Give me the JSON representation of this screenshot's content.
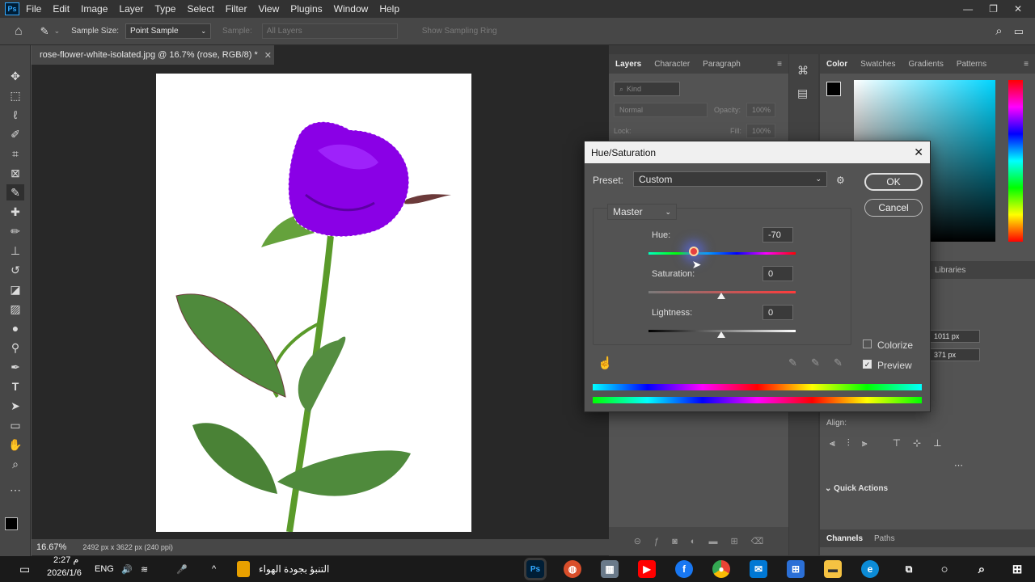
{
  "menubar": {
    "logo": "Ps",
    "items": [
      "File",
      "Edit",
      "Image",
      "Layer",
      "Type",
      "Select",
      "Filter",
      "View",
      "Plugins",
      "Window",
      "Help"
    ],
    "window_controls": [
      "—",
      "❐",
      "✕"
    ]
  },
  "options": {
    "sample_size_label": "Sample Size:",
    "sample_size_value": "Point Sample",
    "sample_label": "Sample:",
    "sample_value": "All Layers",
    "sampling_ring": "Show Sampling Ring"
  },
  "document": {
    "tab_title": "rose-flower-white-isolated.jpg @ 16.7% (rose, RGB/8) *",
    "zoom": "16.67%",
    "info": "2492 px x 3622 px (240 ppi)"
  },
  "layers_panel": {
    "tabs": [
      "Layers",
      "Character",
      "Paragraph"
    ],
    "search_placeholder": "Kind",
    "blend_mode": "Normal",
    "opacity_label": "Opacity:",
    "opacity_value": "100%",
    "lock_label": "Lock:",
    "fill_label": "Fill:",
    "fill_value": "100%"
  },
  "color_panel": {
    "tabs": [
      "Color",
      "Swatches",
      "Gradients",
      "Patterns"
    ],
    "libraries_tab": "Libraries",
    "w_value": "1011 px",
    "h_value": "371 px",
    "align_label": "Align:",
    "quick_actions": "Quick Actions",
    "bottom_tabs": [
      "Channels",
      "Paths"
    ]
  },
  "dialog": {
    "title": "Hue/Saturation",
    "preset_label": "Preset:",
    "preset_value": "Custom",
    "channel": "Master",
    "hue_label": "Hue:",
    "hue_value": "-70",
    "hue_value_num": -70,
    "saturation_label": "Saturation:",
    "saturation_value": "0",
    "lightness_label": "Lightness:",
    "lightness_value": "0",
    "ok_label": "OK",
    "cancel_label": "Cancel",
    "colorize_label": "Colorize",
    "colorize_checked": false,
    "preview_label": "Preview",
    "preview_checked": true
  },
  "taskbar": {
    "time": "2:27 م",
    "date": "2026/1/6",
    "language": "ENG",
    "weather": "التنبؤ بجودة الهواء"
  },
  "colors": {
    "rose": "#8a00e6",
    "stem": "#5a9a2a",
    "accent": "#31a8ff"
  }
}
